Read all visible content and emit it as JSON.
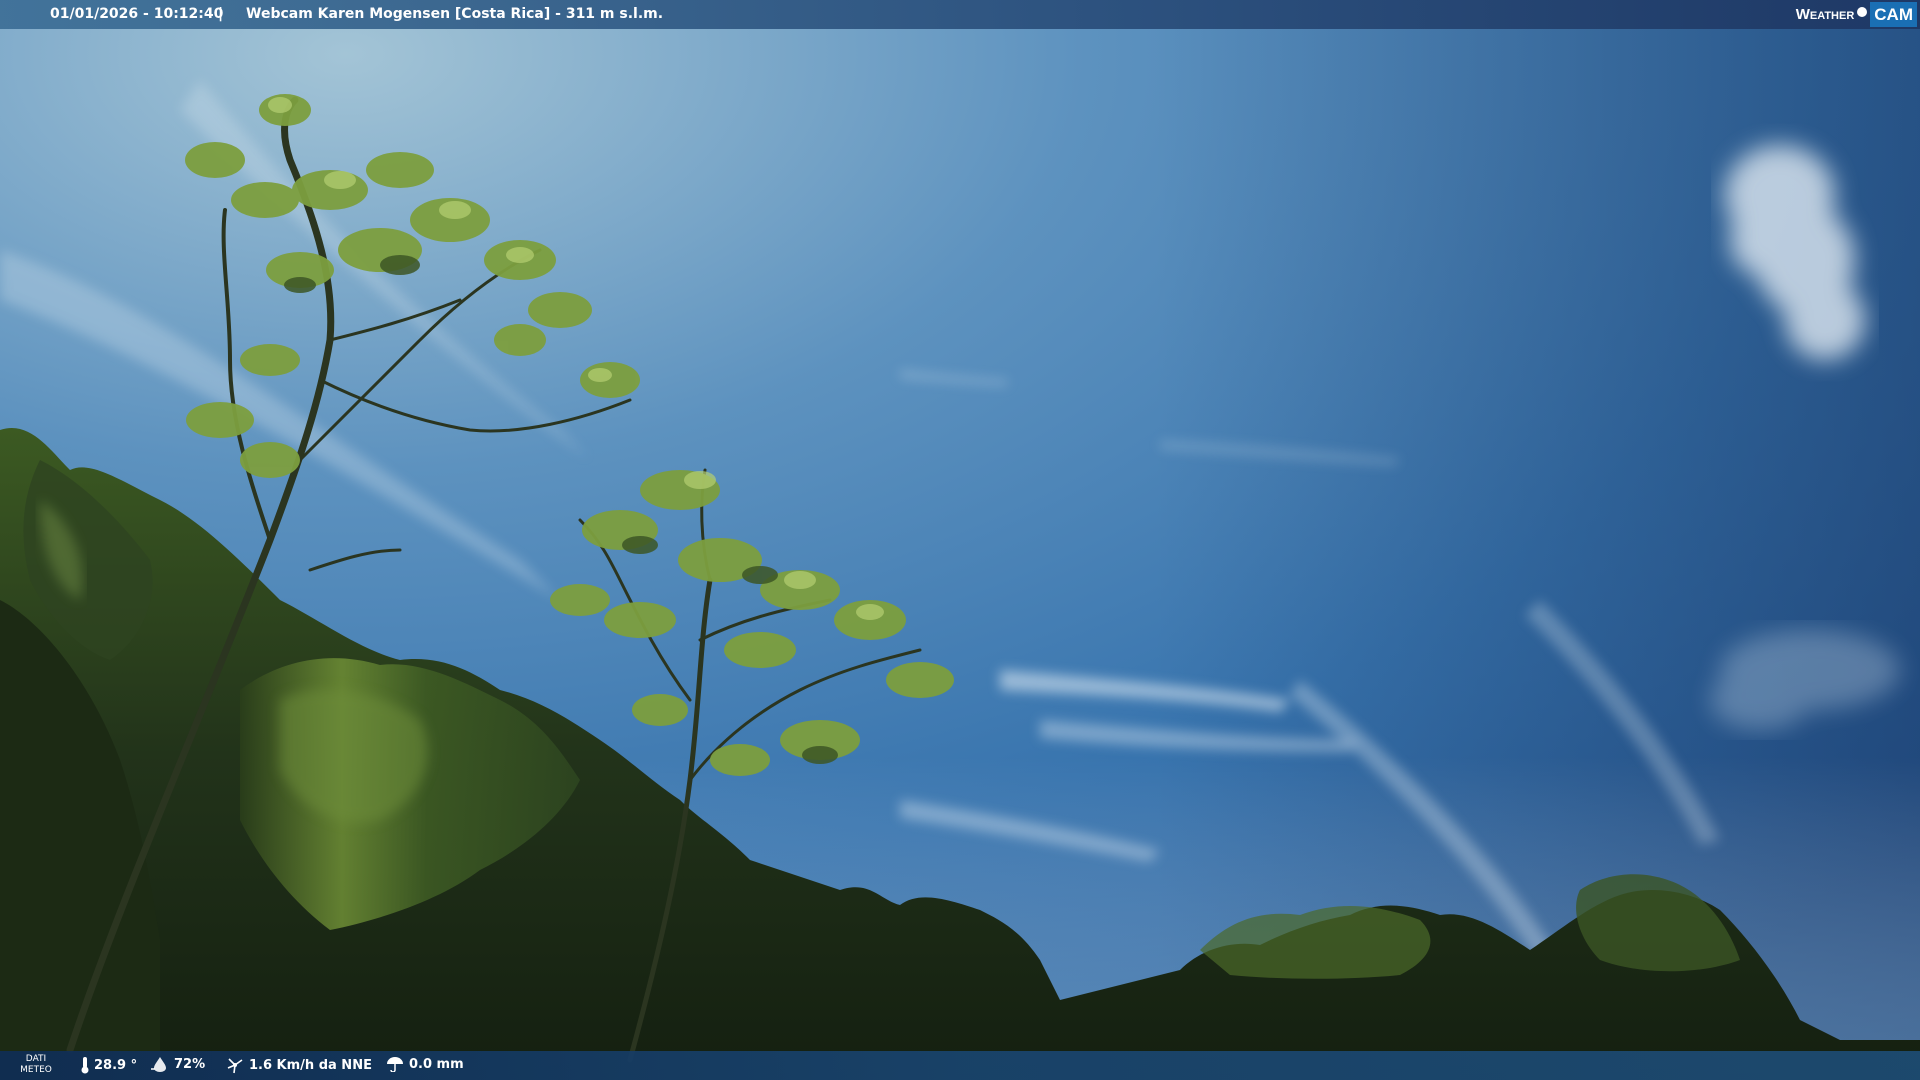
{
  "top_bar": {
    "timestamp": "01/01/2026 - 10:12:40",
    "separator": "|",
    "title": "Webcam Karen Mogensen [Costa Rica] - 311 m s.l.m."
  },
  "brand": {
    "word": "Weather",
    "cam": "CAM"
  },
  "bottom_bar": {
    "dati_label_line1": "DATI",
    "dati_label_line2": "METEO",
    "temperature": "28.9 °",
    "humidity": "72%",
    "wind": "1.6 Km/h da NNE",
    "rain": "0.0 mm"
  },
  "icons": {
    "temperature": "thermometer-icon",
    "humidity": "humidity-drop-icon",
    "wind": "wind-icon",
    "rain": "rain-icon"
  },
  "colors": {
    "sky_top": "#8fb6cf",
    "sky_mid": "#3f78b0",
    "sky_dark": "#22467a",
    "foliage_dark": "#1c2a16",
    "foliage_mid": "#4a6a28",
    "foliage_light": "#a9c86a",
    "brand_accent": "#1a6fb4"
  }
}
